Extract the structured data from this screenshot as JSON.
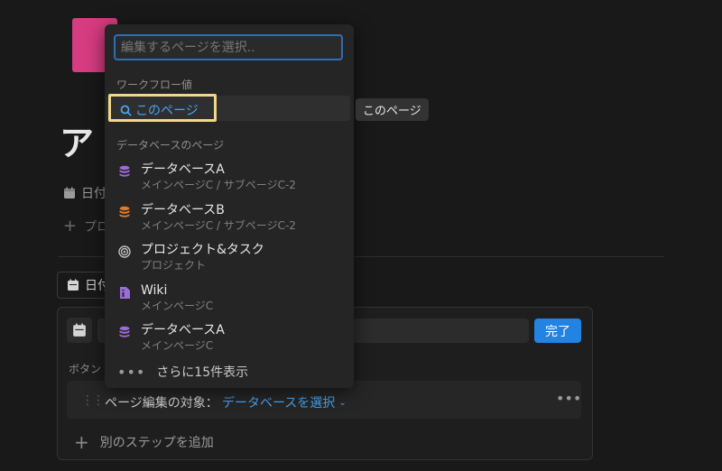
{
  "page": {
    "title": "ア",
    "property_date_label": "日付",
    "property_add_label": "プロ"
  },
  "date_chip": {
    "label": "日付"
  },
  "panel": {
    "done_label": "完了",
    "section_label": "ボタン",
    "step": {
      "prefix": "ページ編集の対象：",
      "select_label": "データベースを選択",
      "more": "•••"
    },
    "add_step_label": "別のステップを追加"
  },
  "dropdown": {
    "search": {
      "placeholder": "編集するページを選択..",
      "value": ""
    },
    "workflow_section": "ワークフロー値",
    "workflow_item": "このページ",
    "tooltip": "このページ",
    "db_section": "データベースのページ",
    "items": [
      {
        "name": "データベースA",
        "path": "メインページC / サブページC-2",
        "icon": "database-icon",
        "color": "#9a6dd7"
      },
      {
        "name": "データベースB",
        "path": "メインページC / サブページC-2",
        "icon": "database-icon",
        "color": "#e07b2c"
      },
      {
        "name": "プロジェクト&タスク",
        "path": "プロジェクト",
        "icon": "target-icon",
        "color": "#bdbdbd"
      },
      {
        "name": "Wiki",
        "path": "メインページC",
        "icon": "document-icon",
        "color": "#9a6dd7"
      },
      {
        "name": "データベースA",
        "path": "メインページC",
        "icon": "database-icon",
        "color": "#9a6dd7"
      }
    ],
    "more_label": "さらに15件表示"
  },
  "colors": {
    "accent": "#2383e2",
    "highlight": "#f0d78c",
    "page_icon": "#d63c80"
  }
}
